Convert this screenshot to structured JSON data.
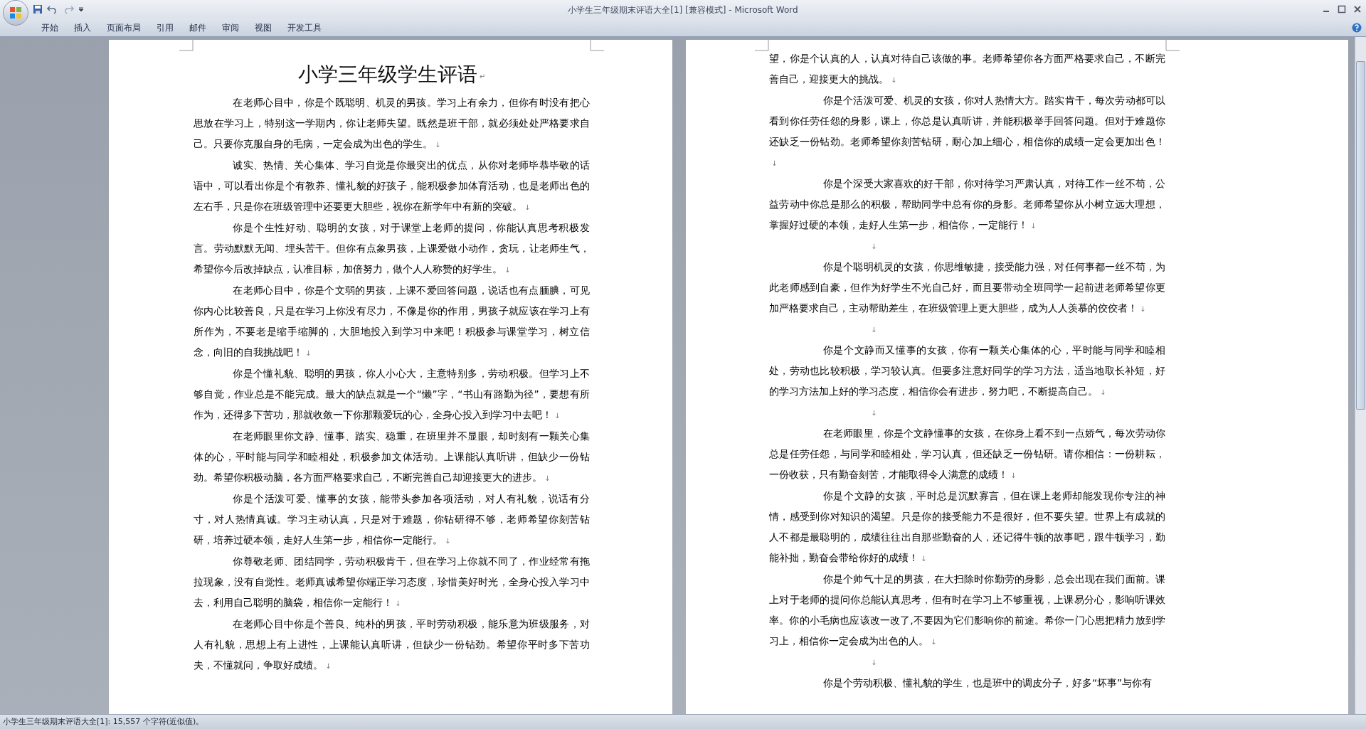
{
  "window": {
    "title": "小学生三年级期末评语大全[1] [兼容模式] - Microsoft Word"
  },
  "ribbon_tabs": [
    {
      "label": "开始"
    },
    {
      "label": "插入"
    },
    {
      "label": "页面布局"
    },
    {
      "label": "引用"
    },
    {
      "label": "邮件"
    },
    {
      "label": "审阅"
    },
    {
      "label": "视图"
    },
    {
      "label": "开发工具"
    }
  ],
  "pages": [
    {
      "blocks": [
        {
          "kind": "title",
          "text": "小学三年级学生评语",
          "mark": "↵"
        },
        {
          "kind": "paragraph",
          "text": "在老师心目中，你是个既聪明、机灵的男孩。学习上有余力，但你有时没有把心思放在学习上，特别这一学期内，你让老师失望。既然是班干部，就必须处处严格要求自己。只要你克服自身的毛病，一定会成为出色的学生。",
          "mark": "↓"
        },
        {
          "kind": "paragraph",
          "text": "诚实、热情、关心集体、学习自觉是你最突出的优点，从你对老师毕恭毕敬的话语中，可以看出你是个有教养、懂礼貌的好孩子，能积极参加体育活动，也是老师出色的左右手，只是你在班级管理中还要更大胆些，祝你在新学年中有新的突破。",
          "mark": "↓"
        },
        {
          "kind": "paragraph",
          "text": "你是个生性好动、聪明的女孩，对于课堂上老师的提问，你能认真思考积极发言。劳动默默无闻、埋头苦干。但你有点象男孩，上课爱做小动作，贪玩，让老师生气，希望你今后改掉缺点，认准目标，加倍努力，做个人人称赞的好学生。",
          "mark": "↓"
        },
        {
          "kind": "paragraph",
          "text": "在老师心目中，你是个文弱的男孩，上课不爱回答问题，说话也有点腼腆，可见你内心比较善良，只是在学习上你没有尽力，不像是你的作用，男孩子就应该在学习上有所作为，不要老是缩手缩脚的，大胆地投入到学习中来吧！积极参与课堂学习，树立信念，向旧的自我挑战吧！",
          "mark": "↓"
        },
        {
          "kind": "paragraph",
          "text": "你是个懂礼貌、聪明的男孩，你人小心大，主意特别多，劳动积极。但学习上不够自觉，作业总是不能完成。最大的缺点就是一个“懒”字，“书山有路勤为径”，要想有所作为，还得多下苦功，那就收敛一下你那颗爱玩的心，全身心投入到学习中去吧！",
          "mark": "↓"
        },
        {
          "kind": "paragraph",
          "text": "在老师眼里你文静、懂事、踏实、稳重，在班里并不显眼，却时刻有一颗关心集体的心，平时能与同学和睦相处，积极参加文体活动。上课能认真听讲，但缺少一份钻劲。希望你积极动脑，各方面严格要求自己，不断完善自己却迎接更大的进步。",
          "mark": "↓"
        },
        {
          "kind": "paragraph",
          "text": "你是个活泼可爱、懂事的女孩，能带头参加各项活动，对人有礼貌，说话有分寸，对人热情真诚。学习主动认真，只是对于难题，你钻研得不够，老师希望你刻苦钻研，培养过硬本领，走好人生第一步，相信你一定能行。",
          "mark": "↓"
        },
        {
          "kind": "paragraph",
          "text": "你尊敬老师、团结同学，劳动积极肯干，但在学习上你就不同了，作业经常有拖拉现象，没有自觉性。老师真诚希望你端正学习态度，珍惜美好时光，全身心投入学习中去，利用自己聪明的脑袋，相信你一定能行！",
          "mark": "↓"
        },
        {
          "kind": "paragraph",
          "text": "在老师心目中你是个善良、纯朴的男孩，平时劳动积极，能乐意为班级服务，对人有礼貌，思想上有上进性，上课能认真听讲，但缺少一份钻劲。希望你平时多下苦功夫，不懂就问，争取好成绩。",
          "mark": "↓"
        }
      ]
    },
    {
      "blocks": [
        {
          "kind": "continued",
          "text": "望，你是个认真的人，认真对待自己该做的事。老师希望你各方面严格要求自己，不断完善自己，迎接更大的挑战。",
          "mark": "↓"
        },
        {
          "kind": "paragraph",
          "text": "你是个活泼可爱、机灵的女孩，你对人热情大方。踏实肯干，每次劳动都可以看到你任劳任怨的身影，课上，你总是认真听讲，并能积极举手回答问题。但对于难题你还缺乏一份钻劲。老师希望你刻苦钻研，耐心加上细心，相信你的成绩一定会更加出色！",
          "mark": "↓"
        },
        {
          "kind": "paragraph",
          "text": "你是个深受大家喜欢的好干部，你对待学习严肃认真，对待工作一丝不苟，公益劳动中你总是那么的积极，帮助同学中总有你的身影。老师希望你从小树立远大理想，掌握好过硬的本领，走好人生第一步，相信你，一定能行！",
          "mark": "↓"
        },
        {
          "kind": "blank",
          "mark": "↓"
        },
        {
          "kind": "paragraph",
          "text": "你是个聪明机灵的女孩，你思维敏捷，接受能力强，对任何事都一丝不苟，为此老师感到自豪，但作为好学生不光自己好，而且要带动全班同学一起前进老师希望你更加严格要求自己，主动帮助差生，在班级管理上更大胆些，成为人人羡慕的佼佼者！",
          "mark": "↓"
        },
        {
          "kind": "blank",
          "mark": "↓"
        },
        {
          "kind": "paragraph",
          "text": "你是个文静而又懂事的女孩，你有一颗关心集体的心，平时能与同学和睦相处，劳动也比较积极，学习较认真。但要多注意好同学的学习方法，适当地取长补短，好的学习方法加上好的学习态度，相信你会有进步，努力吧，不断提高自己。",
          "mark": "↓"
        },
        {
          "kind": "blank",
          "mark": "↓"
        },
        {
          "kind": "paragraph",
          "text": "在老师眼里，你是个文静懂事的女孩，在你身上看不到一点娇气，每次劳动你总是任劳任怨，与同学和睦相处，学习认真，但还缺乏一份钻研。请你相信：一份耕耘，一份收获，只有勤奋刻苦，才能取得令人满意的成绩！",
          "mark": "↓"
        },
        {
          "kind": "paragraph",
          "text": "你是个文静的女孩，平时总是沉默寡言，但在课上老师却能发现你专注的神情，感受到你对知识的渴望。只是你的接受能力不是很好，但不要失望。世界上有成就的人不都是最聪明的，成绩往往出自那些勤奋的人，还记得牛顿的故事吧，跟牛顿学习，勤能补拙，勤奋会带给你好的成绩！",
          "mark": "↓"
        },
        {
          "kind": "paragraph",
          "text": "你是个帅气十足的男孩，在大扫除时你勤劳的身影，总会出现在我们面前。课上对于老师的提问你总能认真思考，但有时在学习上不够重视，上课易分心，影响听课效率。你的小毛病也应该改一改了,不要因为它们影响你的前途。希你一门心思把精力放到学习上，相信你一定会成为出色的人。",
          "mark": "↓"
        },
        {
          "kind": "blank",
          "mark": "↓"
        },
        {
          "kind": "paragraph",
          "text": "你是个劳动积极、懂礼貌的学生，也是班中的调皮分子，好多“坏事”与你有"
        }
      ]
    }
  ],
  "status_bar": {
    "text": "小学生三年级期末评语大全[1]: 15,557 个字符(近似值)。"
  }
}
